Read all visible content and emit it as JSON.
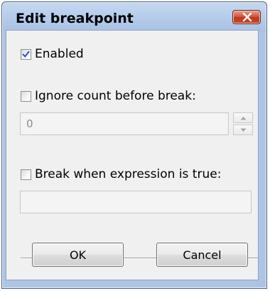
{
  "dialog": {
    "title": "Edit breakpoint"
  },
  "enabled": {
    "label": "Enabled",
    "checked": true
  },
  "ignore_count": {
    "label": "Ignore count before break:",
    "checked": false,
    "value": "0"
  },
  "break_expression": {
    "label": "Break when expression is true:",
    "checked": false,
    "value": ""
  },
  "buttons": {
    "ok_label": "OK",
    "cancel_label": "Cancel"
  },
  "icons": {
    "close": "close-x-icon",
    "check": "checkmark-icon",
    "spin_up": "arrow-up-icon",
    "spin_down": "arrow-down-icon"
  },
  "colors": {
    "titlebar": "#b4cbea",
    "close_button": "#c84a2e",
    "client_background": "#f0f0f0"
  }
}
